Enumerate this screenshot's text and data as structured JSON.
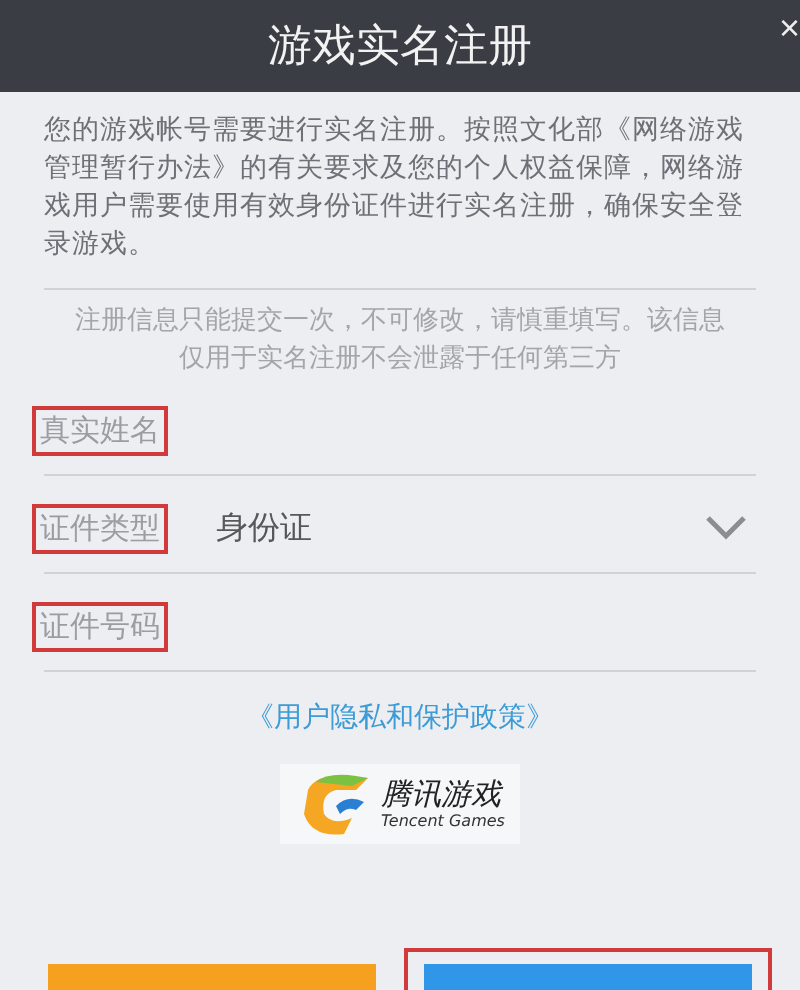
{
  "dialog": {
    "title": "游戏实名注册",
    "close": "×"
  },
  "intro": "您的游戏帐号需要进行实名注册。按照文化部《网络游戏管理暂行办法》的有关要求及您的个人权益保障，网络游戏用户需要使用有效身份证件进行实名注册，确保安全登录游戏。",
  "notice": "注册信息只能提交一次，不可修改，请慎重填写。该信息仅用于实名注册不会泄露于任何第三方",
  "fields": [
    {
      "kind": "text",
      "label": "真实姓名",
      "highlighted": true
    },
    {
      "kind": "select",
      "label": "证件类型",
      "value": "身份证",
      "highlighted": true
    },
    {
      "kind": "text",
      "label": "证件号码",
      "highlighted": true
    }
  ],
  "policy_link": "《用户隐私和保护政策》",
  "logo": {
    "name": "腾讯游戏",
    "subtitle": "Tencent Games"
  },
  "buttons": [
    {
      "kind": "secondary",
      "highlighted": false
    },
    {
      "kind": "primary",
      "highlighted": true
    }
  ]
}
